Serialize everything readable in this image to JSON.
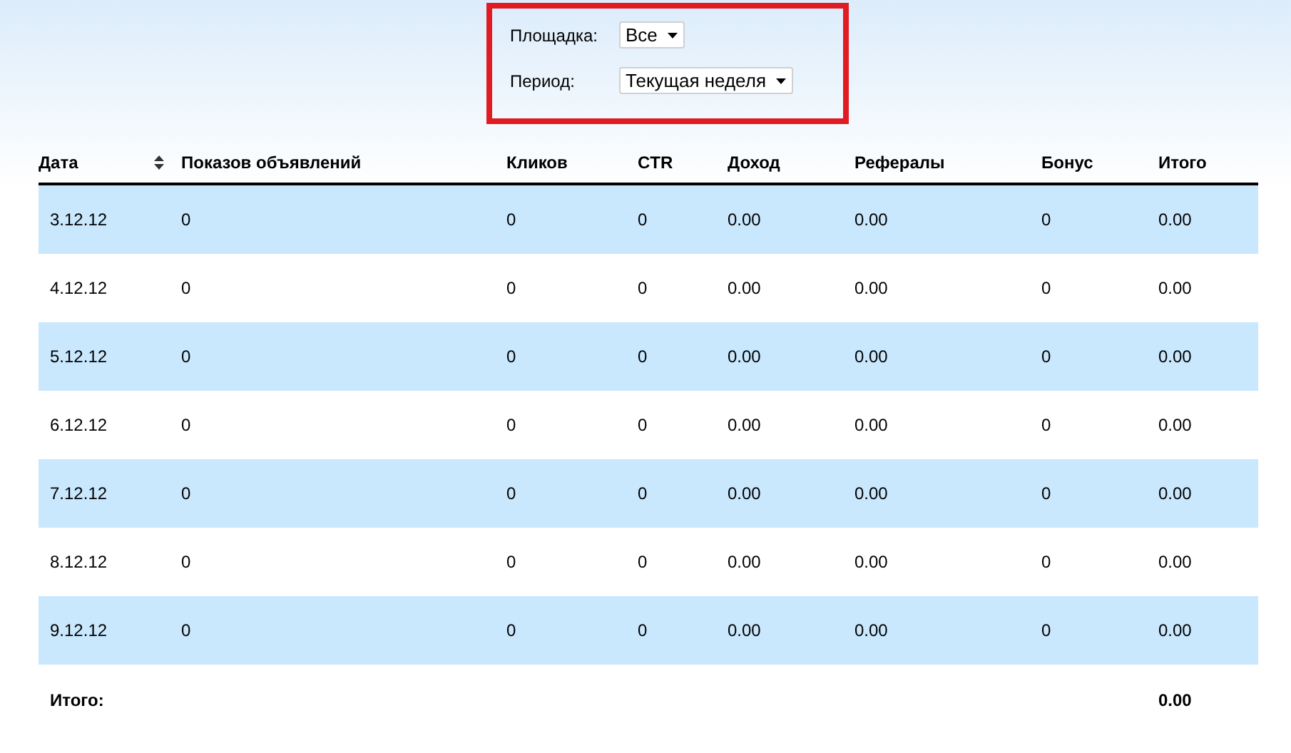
{
  "filters": [
    {
      "label": "Площадка:",
      "value": "Все"
    },
    {
      "label": "Период:",
      "value": "Текущая неделя"
    }
  ],
  "table": {
    "columns": [
      {
        "label": "Дата",
        "sortable": true
      },
      {
        "label": "Показов объявлений",
        "sortable": false
      },
      {
        "label": "Кликов",
        "sortable": false
      },
      {
        "label": "CTR",
        "sortable": false
      },
      {
        "label": "Доход",
        "sortable": false
      },
      {
        "label": "Рефералы",
        "sortable": false
      },
      {
        "label": "Бонус",
        "sortable": false
      },
      {
        "label": "Итого",
        "sortable": false
      }
    ],
    "rows": [
      [
        "3.12.12",
        "0",
        "0",
        "0",
        "0.00",
        "0.00",
        "0",
        "0.00"
      ],
      [
        "4.12.12",
        "0",
        "0",
        "0",
        "0.00",
        "0.00",
        "0",
        "0.00"
      ],
      [
        "5.12.12",
        "0",
        "0",
        "0",
        "0.00",
        "0.00",
        "0",
        "0.00"
      ],
      [
        "6.12.12",
        "0",
        "0",
        "0",
        "0.00",
        "0.00",
        "0",
        "0.00"
      ],
      [
        "7.12.12",
        "0",
        "0",
        "0",
        "0.00",
        "0.00",
        "0",
        "0.00"
      ],
      [
        "8.12.12",
        "0",
        "0",
        "0",
        "0.00",
        "0.00",
        "0",
        "0.00"
      ],
      [
        "9.12.12",
        "0",
        "0",
        "0",
        "0.00",
        "0.00",
        "0",
        "0.00"
      ]
    ],
    "total": {
      "label": "Итого:",
      "value": "0.00"
    }
  }
}
